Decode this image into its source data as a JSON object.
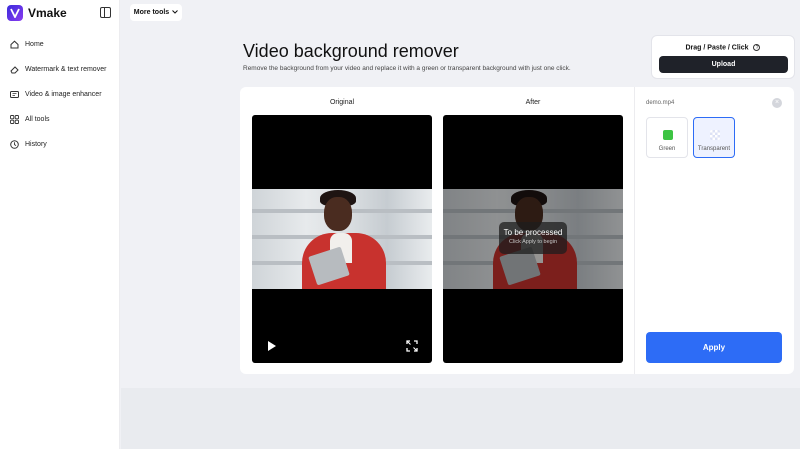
{
  "app": {
    "name": "Vmake"
  },
  "sidebar": {
    "items": [
      {
        "label": "Home",
        "icon": "home-icon"
      },
      {
        "label": "Watermark & text remover",
        "icon": "eraser-icon"
      },
      {
        "label": "Video & image enhancer",
        "icon": "enhance-icon"
      },
      {
        "label": "All tools",
        "icon": "grid-icon"
      },
      {
        "label": "History",
        "icon": "clock-icon"
      }
    ]
  },
  "header": {
    "more_tools": "More tools"
  },
  "page": {
    "title": "Video background remover",
    "subtitle": "Remove the background from your video and replace it with a green or transparent background with just one click."
  },
  "upload": {
    "hint": "Drag / Paste / Click",
    "button": "Upload"
  },
  "preview": {
    "original_label": "Original",
    "after_label": "After",
    "processing_title": "To be processed",
    "processing_hint": "Click Apply to begin"
  },
  "options": {
    "filename": "demo.mp4",
    "backgrounds": [
      {
        "label": "Green",
        "color": "#3dc443",
        "selected": false
      },
      {
        "label": "Transparent",
        "color": "checker",
        "selected": true
      }
    ],
    "apply": "Apply"
  },
  "colors": {
    "accent": "#2d6cf6",
    "dark_button": "#1f2229"
  }
}
